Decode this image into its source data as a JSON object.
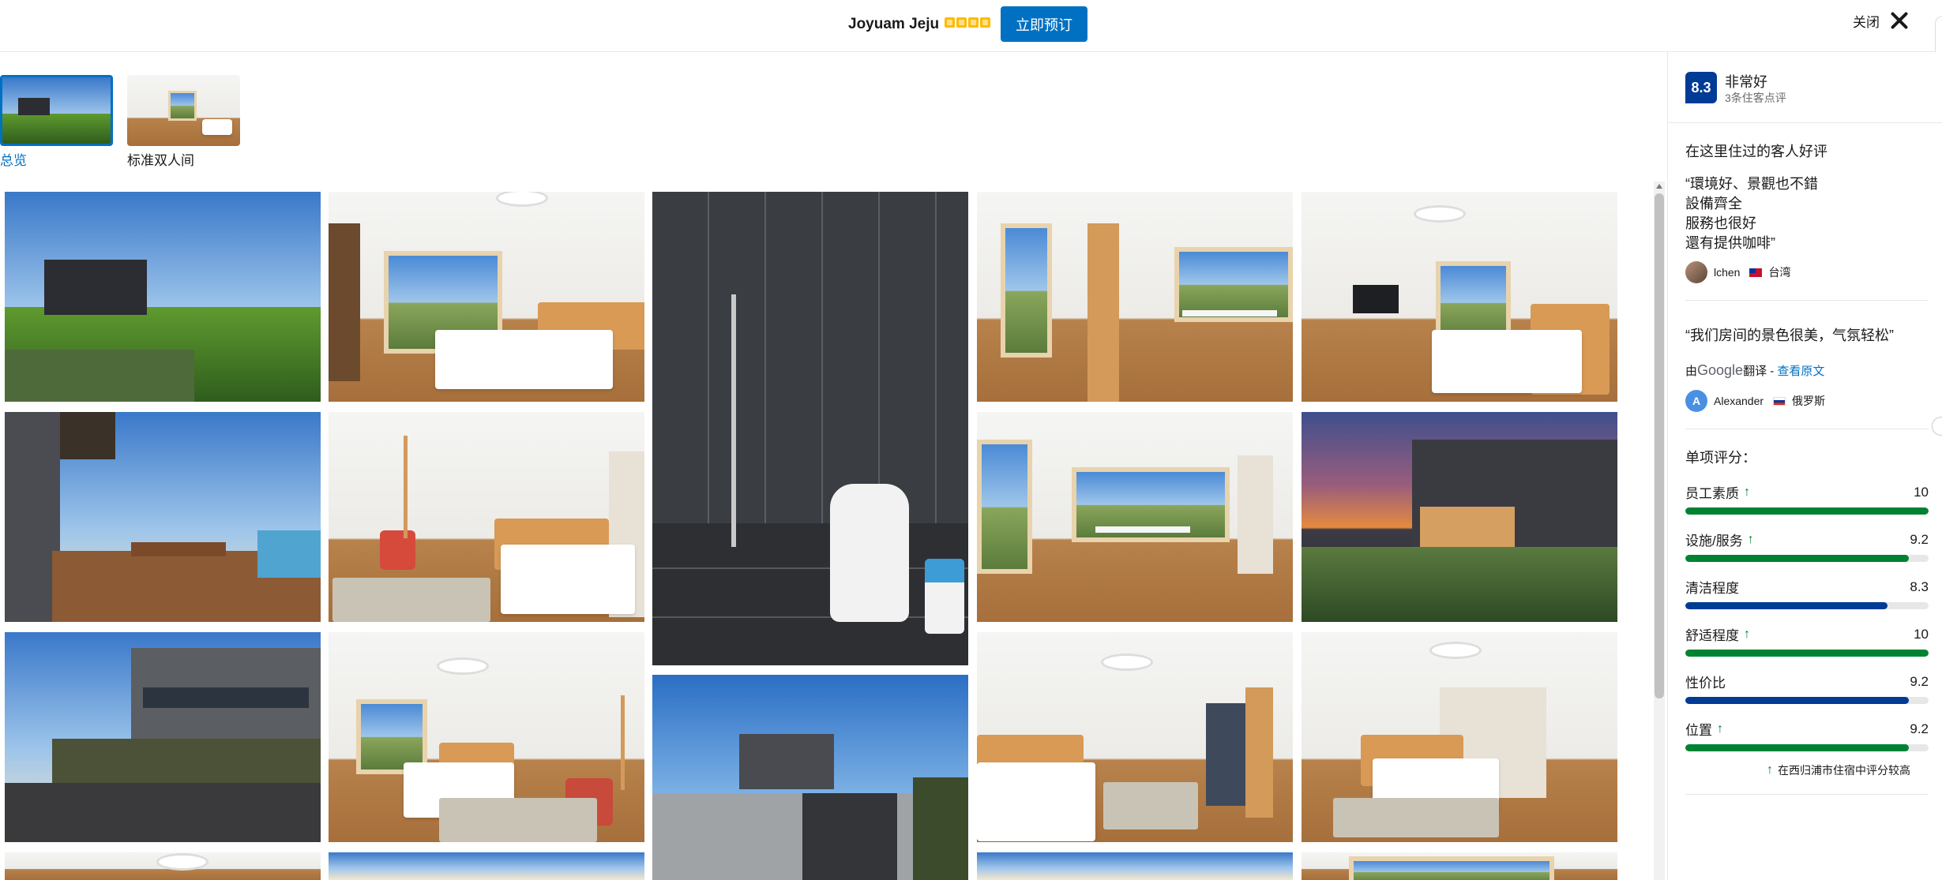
{
  "header": {
    "hotel_name": "Joyuam Jeju",
    "star_count": 4,
    "book_label": "立即预订",
    "close_label": "关闭"
  },
  "room_tabs": [
    {
      "label": "总览",
      "active": true
    },
    {
      "label": "标准双人间",
      "active": false
    }
  ],
  "gallery": {
    "photos": [
      {
        "scene": "exterior-sunset"
      },
      {
        "scene": "bedroom-window"
      },
      {
        "scene": "bathroom-shower"
      },
      {
        "scene": "living-stairs"
      },
      {
        "scene": "bedroom-tv"
      },
      {
        "scene": "deck-ocean"
      },
      {
        "scene": "bedroom-chair"
      },
      {
        "scene": "living-dining"
      },
      {
        "scene": "exterior-dusk"
      },
      {
        "scene": "exterior-road"
      },
      {
        "scene": "bedroom-rug"
      },
      {
        "scene": "exterior-street"
      },
      {
        "scene": "bedroom-loft"
      },
      {
        "scene": "bedroom-curtain"
      }
    ]
  },
  "review_panel": {
    "score": "8.3",
    "score_word": "非常好",
    "review_count": "3条住客点评",
    "guests_liked_title": "在这里住过的客人好评",
    "reviews": [
      {
        "quote_lines": [
          "“環境好、景觀也不錯",
          "設備齊全",
          "服務也很好",
          "還有提供咖啡”"
        ],
        "name": "lchen",
        "country": "台湾",
        "flag": "taiwan-flag-icon"
      },
      {
        "quote_lines": [
          "“我们房间的景色很美，气氛轻松”"
        ],
        "translated_by_prefix": "由",
        "translated_by_brand": "Google",
        "translated_by_suffix": "翻译 - ",
        "view_original": "查看原文",
        "name": "Alexander",
        "avatar_letter": "A",
        "country": "俄罗斯",
        "flag": "russia-flag-icon"
      }
    ],
    "categories_title": "单项评分：",
    "categories": [
      {
        "label": "员工素质",
        "score": "10",
        "value": 10,
        "high": true,
        "color": "#008234"
      },
      {
        "label": "设施/服务",
        "score": "9.2",
        "value": 9.2,
        "high": true,
        "color": "#008234"
      },
      {
        "label": "清洁程度",
        "score": "8.3",
        "value": 8.3,
        "high": false,
        "color": "#003b95"
      },
      {
        "label": "舒适程度",
        "score": "10",
        "value": 10,
        "high": true,
        "color": "#008234"
      },
      {
        "label": "性价比",
        "score": "9.2",
        "value": 9.2,
        "high": false,
        "color": "#003b95"
      },
      {
        "label": "位置",
        "score": "9.2",
        "value": 9.2,
        "high": true,
        "color": "#008234"
      }
    ],
    "high_score_note": "在西归浦市住宿中评分较高"
  },
  "colors": {
    "brand_blue": "#0071c2",
    "score_navy": "#003b95",
    "high_green": "#008234",
    "star_yellow": "#febb02"
  }
}
